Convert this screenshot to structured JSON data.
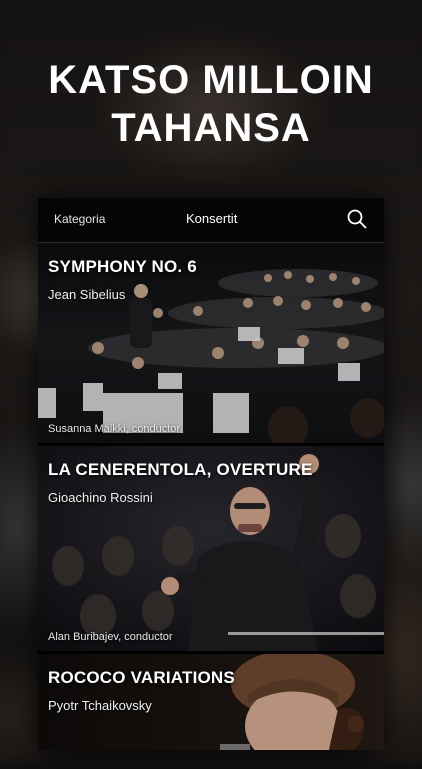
{
  "headline": {
    "line1": "KATSO MILLOIN",
    "line2": "TAHANSA"
  },
  "topbar": {
    "category_label": "Kategoria",
    "concerts_label": "Konsertit",
    "search_icon": "search-icon"
  },
  "concerts": [
    {
      "title": "SYMPHONY NO. 6",
      "composer": "Jean Sibelius",
      "conductor": "Susanna Mälkki, conductor"
    },
    {
      "title": "LA CENERENTOLA, OVERTURE",
      "composer": "Gioachino Rossini",
      "conductor": "Alan Buribajev, conductor"
    },
    {
      "title": "ROCOCO VARIATIONS",
      "composer": "Pyotr Tchaikovsky"
    }
  ]
}
